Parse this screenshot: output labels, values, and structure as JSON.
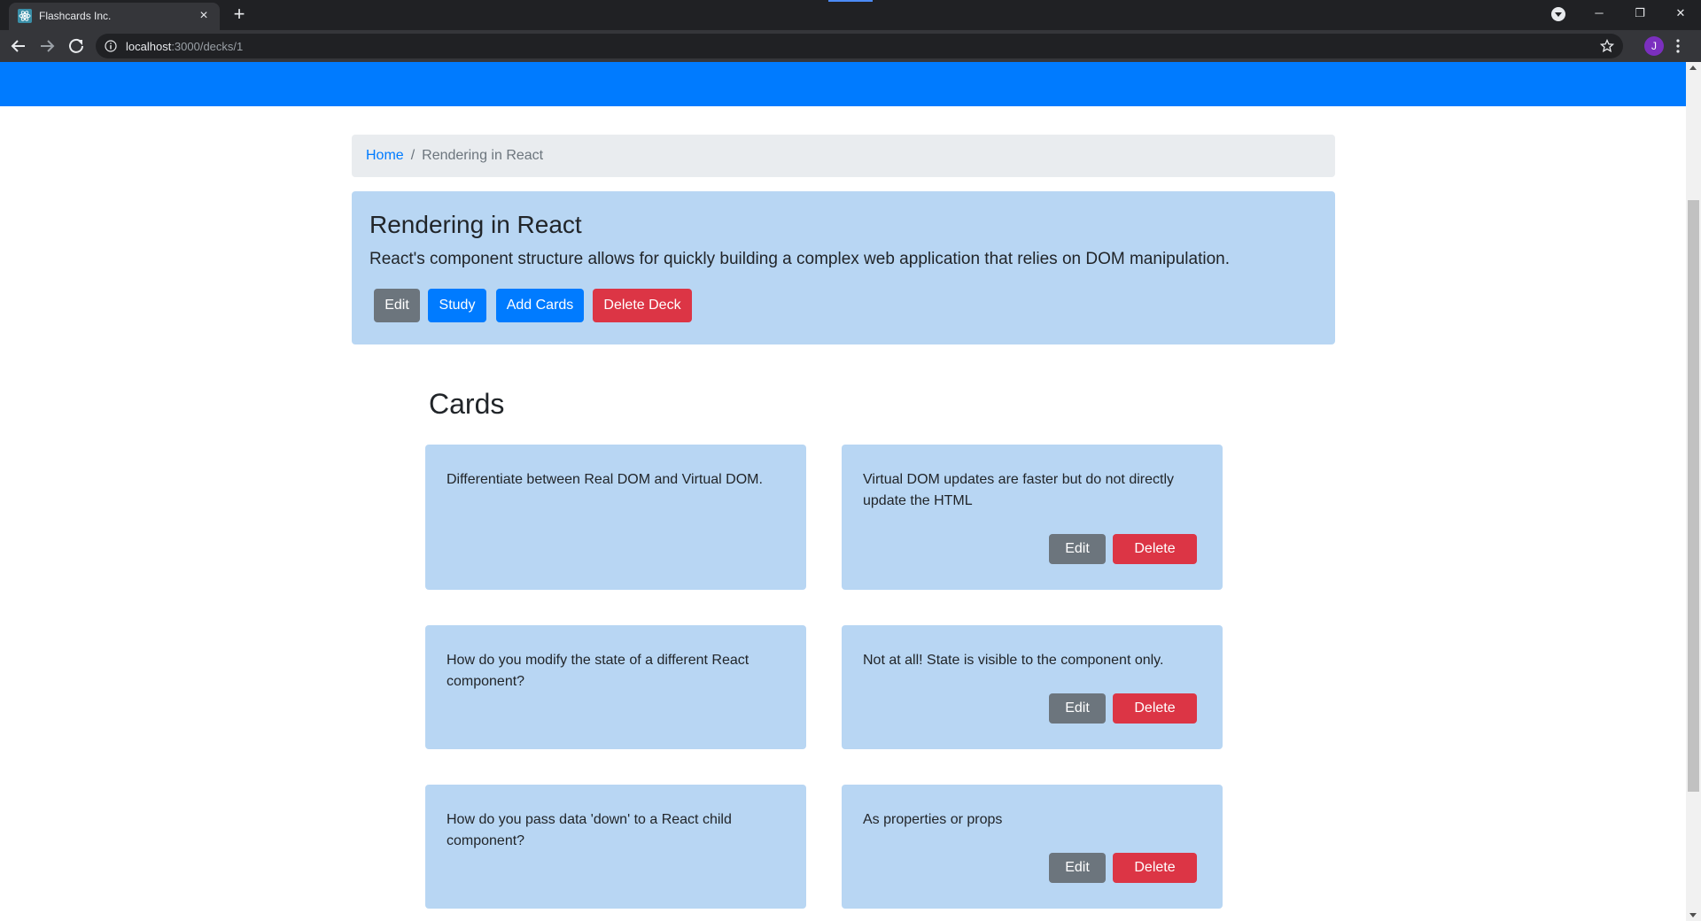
{
  "browser": {
    "tab_title": "Flashcards Inc.",
    "tab_close": "×",
    "new_tab": "+",
    "url_host": "localhost",
    "url_path": ":3000/decks/1",
    "profile_initial": "J",
    "window_minimize": "─",
    "window_restore": "❐",
    "window_close": "✕"
  },
  "breadcrumb": {
    "home": "Home",
    "separator": "/",
    "current": "Rendering in React"
  },
  "deck": {
    "name": "Rendering in React",
    "description": "React's component structure allows for quickly building a complex web application that relies on DOM manipulation.",
    "edit_label": "Edit",
    "study_label": "Study",
    "add_cards_label": "Add Cards",
    "delete_label": "Delete Deck"
  },
  "cards_heading": "Cards",
  "cards": [
    {
      "front": "Differentiate between Real DOM and Virtual DOM.",
      "back": "Virtual DOM updates are faster but do not directly update the HTML",
      "edit_label": "Edit",
      "delete_label": "Delete"
    },
    {
      "front": "How do you modify the state of a different React component?",
      "back": "Not at all! State is visible to the component only.",
      "edit_label": "Edit",
      "delete_label": "Delete"
    },
    {
      "front": "How do you pass data 'down' to a React child component?",
      "back": "As properties or props",
      "edit_label": "Edit",
      "delete_label": "Delete"
    }
  ],
  "colors": {
    "header": "#007bff",
    "card_bg": "#b8d6f3",
    "primary": "#007bff",
    "secondary": "#6c757d",
    "danger": "#dc3545"
  }
}
